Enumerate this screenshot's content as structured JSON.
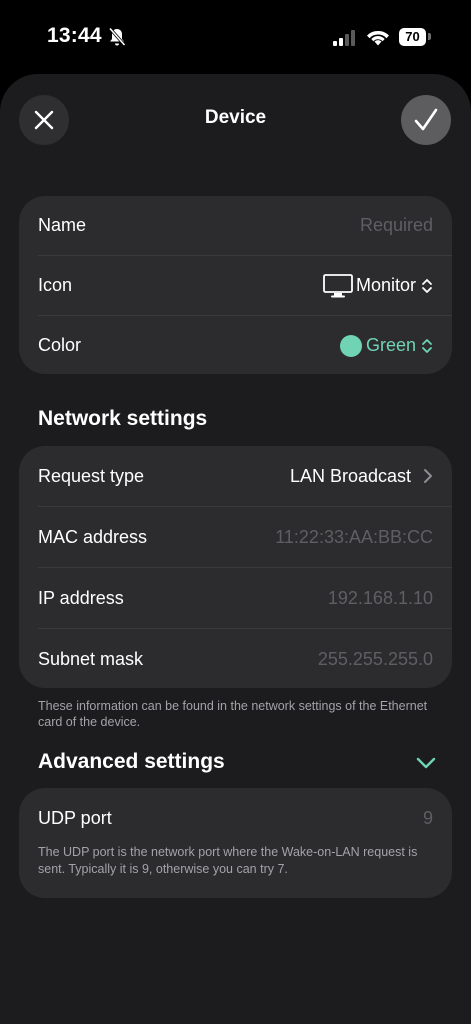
{
  "status": {
    "time": "13:44",
    "battery": "70"
  },
  "header": {
    "title": "Device"
  },
  "general": {
    "name_label": "Name",
    "name_placeholder": "Required",
    "icon_label": "Icon",
    "icon_value": "Monitor",
    "color_label": "Color",
    "color_value": "Green",
    "color_hex": "#6fd3b4"
  },
  "network": {
    "title": "Network settings",
    "request_label": "Request type",
    "request_value": "LAN Broadcast",
    "mac_label": "MAC address",
    "mac_placeholder": "11:22:33:AA:BB:CC",
    "ip_label": "IP address",
    "ip_placeholder": "192.168.1.10",
    "subnet_label": "Subnet mask",
    "subnet_placeholder": "255.255.255.0",
    "footnote": "These information can be found in the network settings of the Ethernet card of the device."
  },
  "advanced": {
    "title": "Advanced settings",
    "udp_label": "UDP port",
    "udp_placeholder": "9",
    "udp_note": "The UDP port is the network port where the Wake-on-LAN request is sent. Typically it is 9, otherwise you can try 7."
  }
}
